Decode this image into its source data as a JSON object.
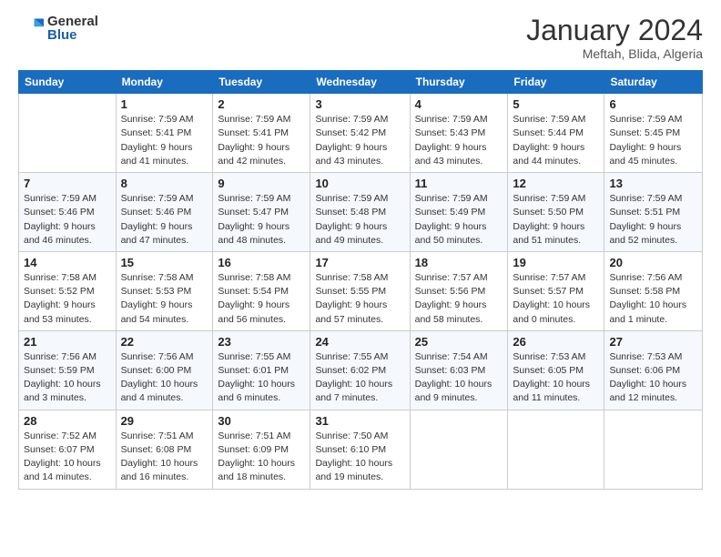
{
  "logo": {
    "general": "General",
    "blue": "Blue"
  },
  "header": {
    "title": "January 2024",
    "subtitle": "Meftah, Blida, Algeria"
  },
  "columns": [
    "Sunday",
    "Monday",
    "Tuesday",
    "Wednesday",
    "Thursday",
    "Friday",
    "Saturday"
  ],
  "weeks": [
    [
      {
        "day": "",
        "info": ""
      },
      {
        "day": "1",
        "info": "Sunrise: 7:59 AM\nSunset: 5:41 PM\nDaylight: 9 hours\nand 41 minutes."
      },
      {
        "day": "2",
        "info": "Sunrise: 7:59 AM\nSunset: 5:41 PM\nDaylight: 9 hours\nand 42 minutes."
      },
      {
        "day": "3",
        "info": "Sunrise: 7:59 AM\nSunset: 5:42 PM\nDaylight: 9 hours\nand 43 minutes."
      },
      {
        "day": "4",
        "info": "Sunrise: 7:59 AM\nSunset: 5:43 PM\nDaylight: 9 hours\nand 43 minutes."
      },
      {
        "day": "5",
        "info": "Sunrise: 7:59 AM\nSunset: 5:44 PM\nDaylight: 9 hours\nand 44 minutes."
      },
      {
        "day": "6",
        "info": "Sunrise: 7:59 AM\nSunset: 5:45 PM\nDaylight: 9 hours\nand 45 minutes."
      }
    ],
    [
      {
        "day": "7",
        "info": "Sunrise: 7:59 AM\nSunset: 5:46 PM\nDaylight: 9 hours\nand 46 minutes."
      },
      {
        "day": "8",
        "info": "Sunrise: 7:59 AM\nSunset: 5:46 PM\nDaylight: 9 hours\nand 47 minutes."
      },
      {
        "day": "9",
        "info": "Sunrise: 7:59 AM\nSunset: 5:47 PM\nDaylight: 9 hours\nand 48 minutes."
      },
      {
        "day": "10",
        "info": "Sunrise: 7:59 AM\nSunset: 5:48 PM\nDaylight: 9 hours\nand 49 minutes."
      },
      {
        "day": "11",
        "info": "Sunrise: 7:59 AM\nSunset: 5:49 PM\nDaylight: 9 hours\nand 50 minutes."
      },
      {
        "day": "12",
        "info": "Sunrise: 7:59 AM\nSunset: 5:50 PM\nDaylight: 9 hours\nand 51 minutes."
      },
      {
        "day": "13",
        "info": "Sunrise: 7:59 AM\nSunset: 5:51 PM\nDaylight: 9 hours\nand 52 minutes."
      }
    ],
    [
      {
        "day": "14",
        "info": "Sunrise: 7:58 AM\nSunset: 5:52 PM\nDaylight: 9 hours\nand 53 minutes."
      },
      {
        "day": "15",
        "info": "Sunrise: 7:58 AM\nSunset: 5:53 PM\nDaylight: 9 hours\nand 54 minutes."
      },
      {
        "day": "16",
        "info": "Sunrise: 7:58 AM\nSunset: 5:54 PM\nDaylight: 9 hours\nand 56 minutes."
      },
      {
        "day": "17",
        "info": "Sunrise: 7:58 AM\nSunset: 5:55 PM\nDaylight: 9 hours\nand 57 minutes."
      },
      {
        "day": "18",
        "info": "Sunrise: 7:57 AM\nSunset: 5:56 PM\nDaylight: 9 hours\nand 58 minutes."
      },
      {
        "day": "19",
        "info": "Sunrise: 7:57 AM\nSunset: 5:57 PM\nDaylight: 10 hours\nand 0 minutes."
      },
      {
        "day": "20",
        "info": "Sunrise: 7:56 AM\nSunset: 5:58 PM\nDaylight: 10 hours\nand 1 minute."
      }
    ],
    [
      {
        "day": "21",
        "info": "Sunrise: 7:56 AM\nSunset: 5:59 PM\nDaylight: 10 hours\nand 3 minutes."
      },
      {
        "day": "22",
        "info": "Sunrise: 7:56 AM\nSunset: 6:00 PM\nDaylight: 10 hours\nand 4 minutes."
      },
      {
        "day": "23",
        "info": "Sunrise: 7:55 AM\nSunset: 6:01 PM\nDaylight: 10 hours\nand 6 minutes."
      },
      {
        "day": "24",
        "info": "Sunrise: 7:55 AM\nSunset: 6:02 PM\nDaylight: 10 hours\nand 7 minutes."
      },
      {
        "day": "25",
        "info": "Sunrise: 7:54 AM\nSunset: 6:03 PM\nDaylight: 10 hours\nand 9 minutes."
      },
      {
        "day": "26",
        "info": "Sunrise: 7:53 AM\nSunset: 6:05 PM\nDaylight: 10 hours\nand 11 minutes."
      },
      {
        "day": "27",
        "info": "Sunrise: 7:53 AM\nSunset: 6:06 PM\nDaylight: 10 hours\nand 12 minutes."
      }
    ],
    [
      {
        "day": "28",
        "info": "Sunrise: 7:52 AM\nSunset: 6:07 PM\nDaylight: 10 hours\nand 14 minutes."
      },
      {
        "day": "29",
        "info": "Sunrise: 7:51 AM\nSunset: 6:08 PM\nDaylight: 10 hours\nand 16 minutes."
      },
      {
        "day": "30",
        "info": "Sunrise: 7:51 AM\nSunset: 6:09 PM\nDaylight: 10 hours\nand 18 minutes."
      },
      {
        "day": "31",
        "info": "Sunrise: 7:50 AM\nSunset: 6:10 PM\nDaylight: 10 hours\nand 19 minutes."
      },
      {
        "day": "",
        "info": ""
      },
      {
        "day": "",
        "info": ""
      },
      {
        "day": "",
        "info": ""
      }
    ]
  ]
}
